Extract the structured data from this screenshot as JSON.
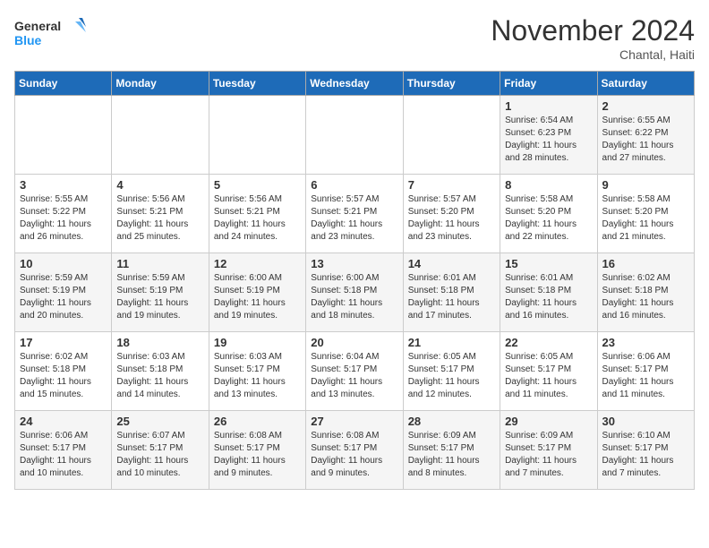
{
  "header": {
    "logo_general": "General",
    "logo_blue": "Blue",
    "month_title": "November 2024",
    "subtitle": "Chantal, Haiti"
  },
  "days_of_week": [
    "Sunday",
    "Monday",
    "Tuesday",
    "Wednesday",
    "Thursday",
    "Friday",
    "Saturday"
  ],
  "weeks": [
    [
      {
        "day": null
      },
      {
        "day": null
      },
      {
        "day": null
      },
      {
        "day": null
      },
      {
        "day": null
      },
      {
        "day": "1",
        "sunrise": "6:54 AM",
        "sunset": "6:23 PM",
        "daylight": "11 hours and 28 minutes."
      },
      {
        "day": "2",
        "sunrise": "6:55 AM",
        "sunset": "6:22 PM",
        "daylight": "11 hours and 27 minutes."
      }
    ],
    [
      {
        "day": "3",
        "sunrise": "5:55 AM",
        "sunset": "5:22 PM",
        "daylight": "11 hours and 26 minutes."
      },
      {
        "day": "4",
        "sunrise": "5:56 AM",
        "sunset": "5:21 PM",
        "daylight": "11 hours and 25 minutes."
      },
      {
        "day": "5",
        "sunrise": "5:56 AM",
        "sunset": "5:21 PM",
        "daylight": "11 hours and 24 minutes."
      },
      {
        "day": "6",
        "sunrise": "5:57 AM",
        "sunset": "5:21 PM",
        "daylight": "11 hours and 23 minutes."
      },
      {
        "day": "7",
        "sunrise": "5:57 AM",
        "sunset": "5:20 PM",
        "daylight": "11 hours and 23 minutes."
      },
      {
        "day": "8",
        "sunrise": "5:58 AM",
        "sunset": "5:20 PM",
        "daylight": "11 hours and 22 minutes."
      },
      {
        "day": "9",
        "sunrise": "5:58 AM",
        "sunset": "5:20 PM",
        "daylight": "11 hours and 21 minutes."
      }
    ],
    [
      {
        "day": "10",
        "sunrise": "5:59 AM",
        "sunset": "5:19 PM",
        "daylight": "11 hours and 20 minutes."
      },
      {
        "day": "11",
        "sunrise": "5:59 AM",
        "sunset": "5:19 PM",
        "daylight": "11 hours and 19 minutes."
      },
      {
        "day": "12",
        "sunrise": "6:00 AM",
        "sunset": "5:19 PM",
        "daylight": "11 hours and 19 minutes."
      },
      {
        "day": "13",
        "sunrise": "6:00 AM",
        "sunset": "5:18 PM",
        "daylight": "11 hours and 18 minutes."
      },
      {
        "day": "14",
        "sunrise": "6:01 AM",
        "sunset": "5:18 PM",
        "daylight": "11 hours and 17 minutes."
      },
      {
        "day": "15",
        "sunrise": "6:01 AM",
        "sunset": "5:18 PM",
        "daylight": "11 hours and 16 minutes."
      },
      {
        "day": "16",
        "sunrise": "6:02 AM",
        "sunset": "5:18 PM",
        "daylight": "11 hours and 16 minutes."
      }
    ],
    [
      {
        "day": "17",
        "sunrise": "6:02 AM",
        "sunset": "5:18 PM",
        "daylight": "11 hours and 15 minutes."
      },
      {
        "day": "18",
        "sunrise": "6:03 AM",
        "sunset": "5:18 PM",
        "daylight": "11 hours and 14 minutes."
      },
      {
        "day": "19",
        "sunrise": "6:03 AM",
        "sunset": "5:17 PM",
        "daylight": "11 hours and 13 minutes."
      },
      {
        "day": "20",
        "sunrise": "6:04 AM",
        "sunset": "5:17 PM",
        "daylight": "11 hours and 13 minutes."
      },
      {
        "day": "21",
        "sunrise": "6:05 AM",
        "sunset": "5:17 PM",
        "daylight": "11 hours and 12 minutes."
      },
      {
        "day": "22",
        "sunrise": "6:05 AM",
        "sunset": "5:17 PM",
        "daylight": "11 hours and 11 minutes."
      },
      {
        "day": "23",
        "sunrise": "6:06 AM",
        "sunset": "5:17 PM",
        "daylight": "11 hours and 11 minutes."
      }
    ],
    [
      {
        "day": "24",
        "sunrise": "6:06 AM",
        "sunset": "5:17 PM",
        "daylight": "11 hours and 10 minutes."
      },
      {
        "day": "25",
        "sunrise": "6:07 AM",
        "sunset": "5:17 PM",
        "daylight": "11 hours and 10 minutes."
      },
      {
        "day": "26",
        "sunrise": "6:08 AM",
        "sunset": "5:17 PM",
        "daylight": "11 hours and 9 minutes."
      },
      {
        "day": "27",
        "sunrise": "6:08 AM",
        "sunset": "5:17 PM",
        "daylight": "11 hours and 9 minutes."
      },
      {
        "day": "28",
        "sunrise": "6:09 AM",
        "sunset": "5:17 PM",
        "daylight": "11 hours and 8 minutes."
      },
      {
        "day": "29",
        "sunrise": "6:09 AM",
        "sunset": "5:17 PM",
        "daylight": "11 hours and 7 minutes."
      },
      {
        "day": "30",
        "sunrise": "6:10 AM",
        "sunset": "5:17 PM",
        "daylight": "11 hours and 7 minutes."
      }
    ]
  ]
}
